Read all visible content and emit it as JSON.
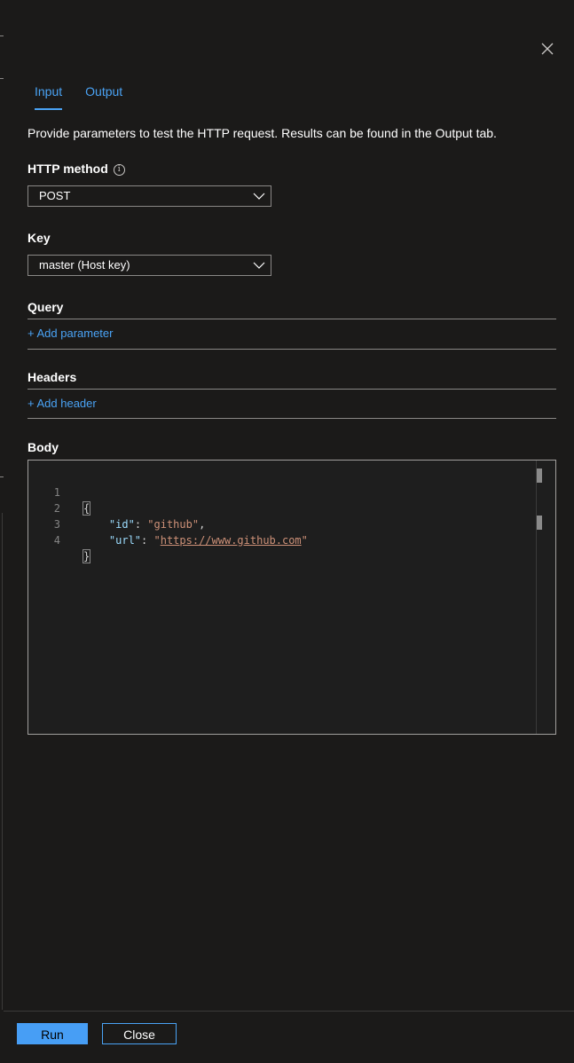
{
  "panel": {
    "close_icon": "close-icon"
  },
  "tabs": [
    {
      "label": "Input",
      "active": true
    },
    {
      "label": "Output",
      "active": false
    }
  ],
  "description": "Provide parameters to test the HTTP request. Results can be found in the Output tab.",
  "http_method": {
    "label": "HTTP method",
    "info_icon": "info-icon",
    "value": "POST"
  },
  "key": {
    "label": "Key",
    "value": "master (Host key)"
  },
  "query": {
    "label": "Query",
    "add_label": "+ Add parameter"
  },
  "headers": {
    "label": "Headers",
    "add_label": "+ Add header"
  },
  "body": {
    "label": "Body",
    "line_numbers": [
      "1",
      "2",
      "3",
      "4"
    ],
    "lines": {
      "open_brace": "{",
      "id_key": "\"id\"",
      "id_value": "\"github\"",
      "url_key": "\"url\"",
      "url_value_open": "\"",
      "url_value": "https://www.github.com",
      "url_value_close": "\"",
      "close_brace": "}"
    }
  },
  "footer": {
    "run_label": "Run",
    "close_label": "Close"
  },
  "colors": {
    "accent": "#4aa3f5",
    "primary_button": "#479ef5",
    "background": "#1b1a19"
  }
}
